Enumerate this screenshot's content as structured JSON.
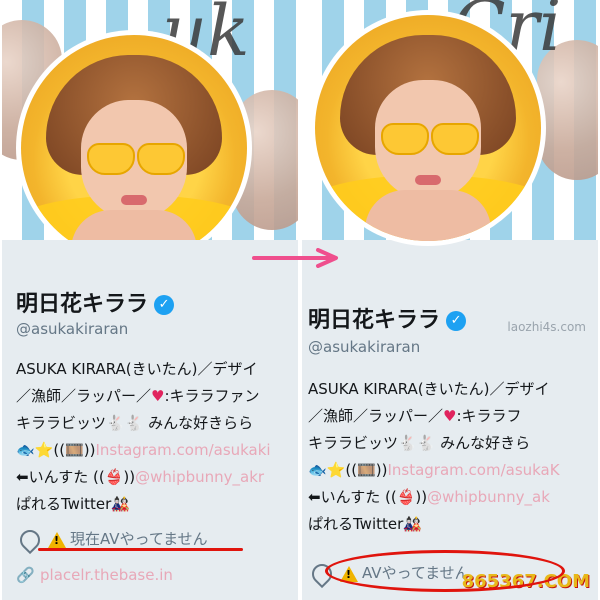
{
  "left": {
    "name": "明日花キララ",
    "handle": "@asukakiraran",
    "bio_lines": [
      "ASUKA KIRARA(きいたん)／デザイ",
      "／漁師／ラッパー／",
      "キララビッツ🐇🐇 みんな好きらら",
      "🐟⭐((🎞️))",
      "⬅いんすた ((👙))",
      "ぱれるTwitter🎎"
    ],
    "bio_heart_suffix": ":キララファン",
    "instagram_link": "Instagram.com/asukaki",
    "whip_link": "@whipbunny_akr",
    "location_text": "現在AVやってません",
    "website": "placelr.thebase.in"
  },
  "right": {
    "name": "明日花キララ",
    "handle": "@asukakiraran",
    "bio_lines": [
      "ASUKA KIRARA(きいたん)／デザイ",
      "／漁師／ラッパー／",
      "キララビッツ🐇🐇 みんな好きら",
      "🐟⭐((🎞️))",
      "⬅いんすた ((👙))",
      "ぱれるTwitter🎎"
    ],
    "bio_heart_suffix": ":キララフ",
    "instagram_link": "Instagram.com/asukaK",
    "whip_link": "@whipbunny_ak",
    "location_text": "AVやってません"
  },
  "banner_word_left": "uk",
  "banner_word_right": "Cri",
  "watermark_small": "laozhi4s.com",
  "site_stamp": "865367.COM",
  "colors": {
    "accent_link": "#e8a8b8",
    "verified": "#1da1f2",
    "annotation_red": "#e0140d",
    "arrow_pink": "#ef4f8d"
  },
  "icons": {
    "verified": "verified-check-icon",
    "location": "location-pin-icon",
    "link": "link-icon",
    "warning": "warning-icon",
    "arrow": "right-arrow-icon"
  }
}
